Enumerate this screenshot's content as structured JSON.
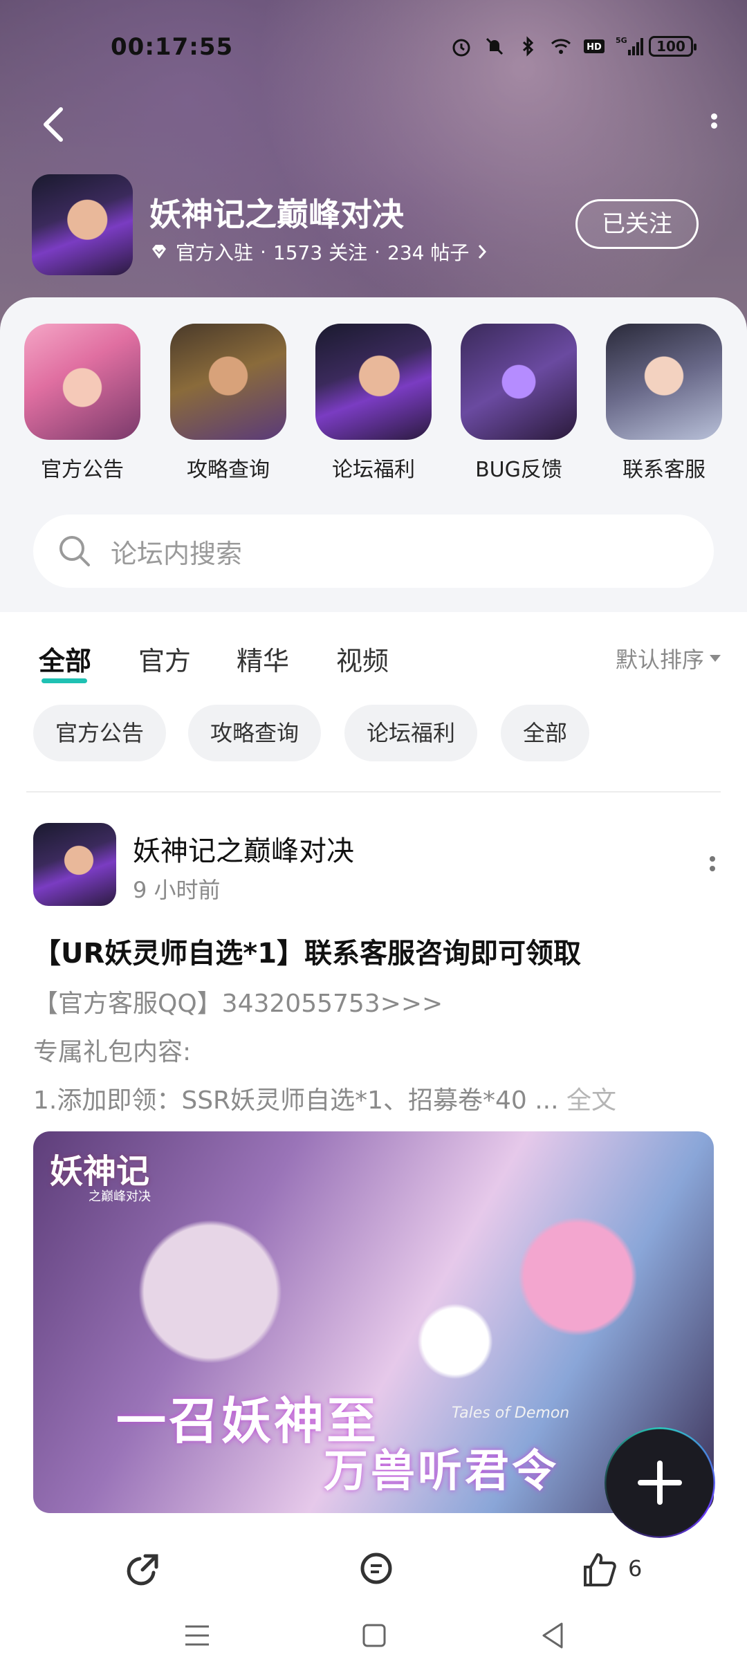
{
  "status_bar": {
    "time": "00:17:55",
    "battery": "100",
    "icons": [
      "alarm-icon",
      "mute-icon",
      "bluetooth-icon",
      "wifi-icon",
      "hd-icon",
      "5g-signal-icon"
    ]
  },
  "forum": {
    "title": "妖神记之巅峰对决",
    "meta_official": "官方入驻",
    "meta_follow": "1573 关注",
    "meta_posts": "234 帖子",
    "meta_sep": "·",
    "follow_label": "已关注"
  },
  "shortcuts": [
    {
      "label": "官方公告"
    },
    {
      "label": "攻略查询"
    },
    {
      "label": "论坛福利"
    },
    {
      "label": "BUG反馈"
    },
    {
      "label": "联系客服"
    }
  ],
  "search": {
    "placeholder": "论坛内搜索"
  },
  "tabs": [
    {
      "label": "全部"
    },
    {
      "label": "官方"
    },
    {
      "label": "精华"
    },
    {
      "label": "视频"
    }
  ],
  "sort_label": "默认排序",
  "chips": [
    {
      "label": "官方公告"
    },
    {
      "label": "攻略查询"
    },
    {
      "label": "论坛福利"
    },
    {
      "label": "全部"
    }
  ],
  "post": {
    "author": "妖神记之巅峰对决",
    "time": "9 小时前",
    "title": "【UR妖灵师自选*1】联系客服咨询即可领取",
    "line1": "【官方客服QQ】3432055753>>>",
    "line2": "专属礼包内容:",
    "line3": "1.添加即领：SSR妖灵师自选*1、招募卷*40 ...",
    "full_text": "全文",
    "image_logo": "妖神记",
    "image_logo_sub": "之巅峰对决",
    "image_text1": "一召妖神至",
    "image_text2": "万兽听君令",
    "image_caption": "Tales of Demon",
    "like_count": "6"
  },
  "colors": {
    "accent": "#1fc1b3",
    "page_bg": "#f4f5f8"
  }
}
